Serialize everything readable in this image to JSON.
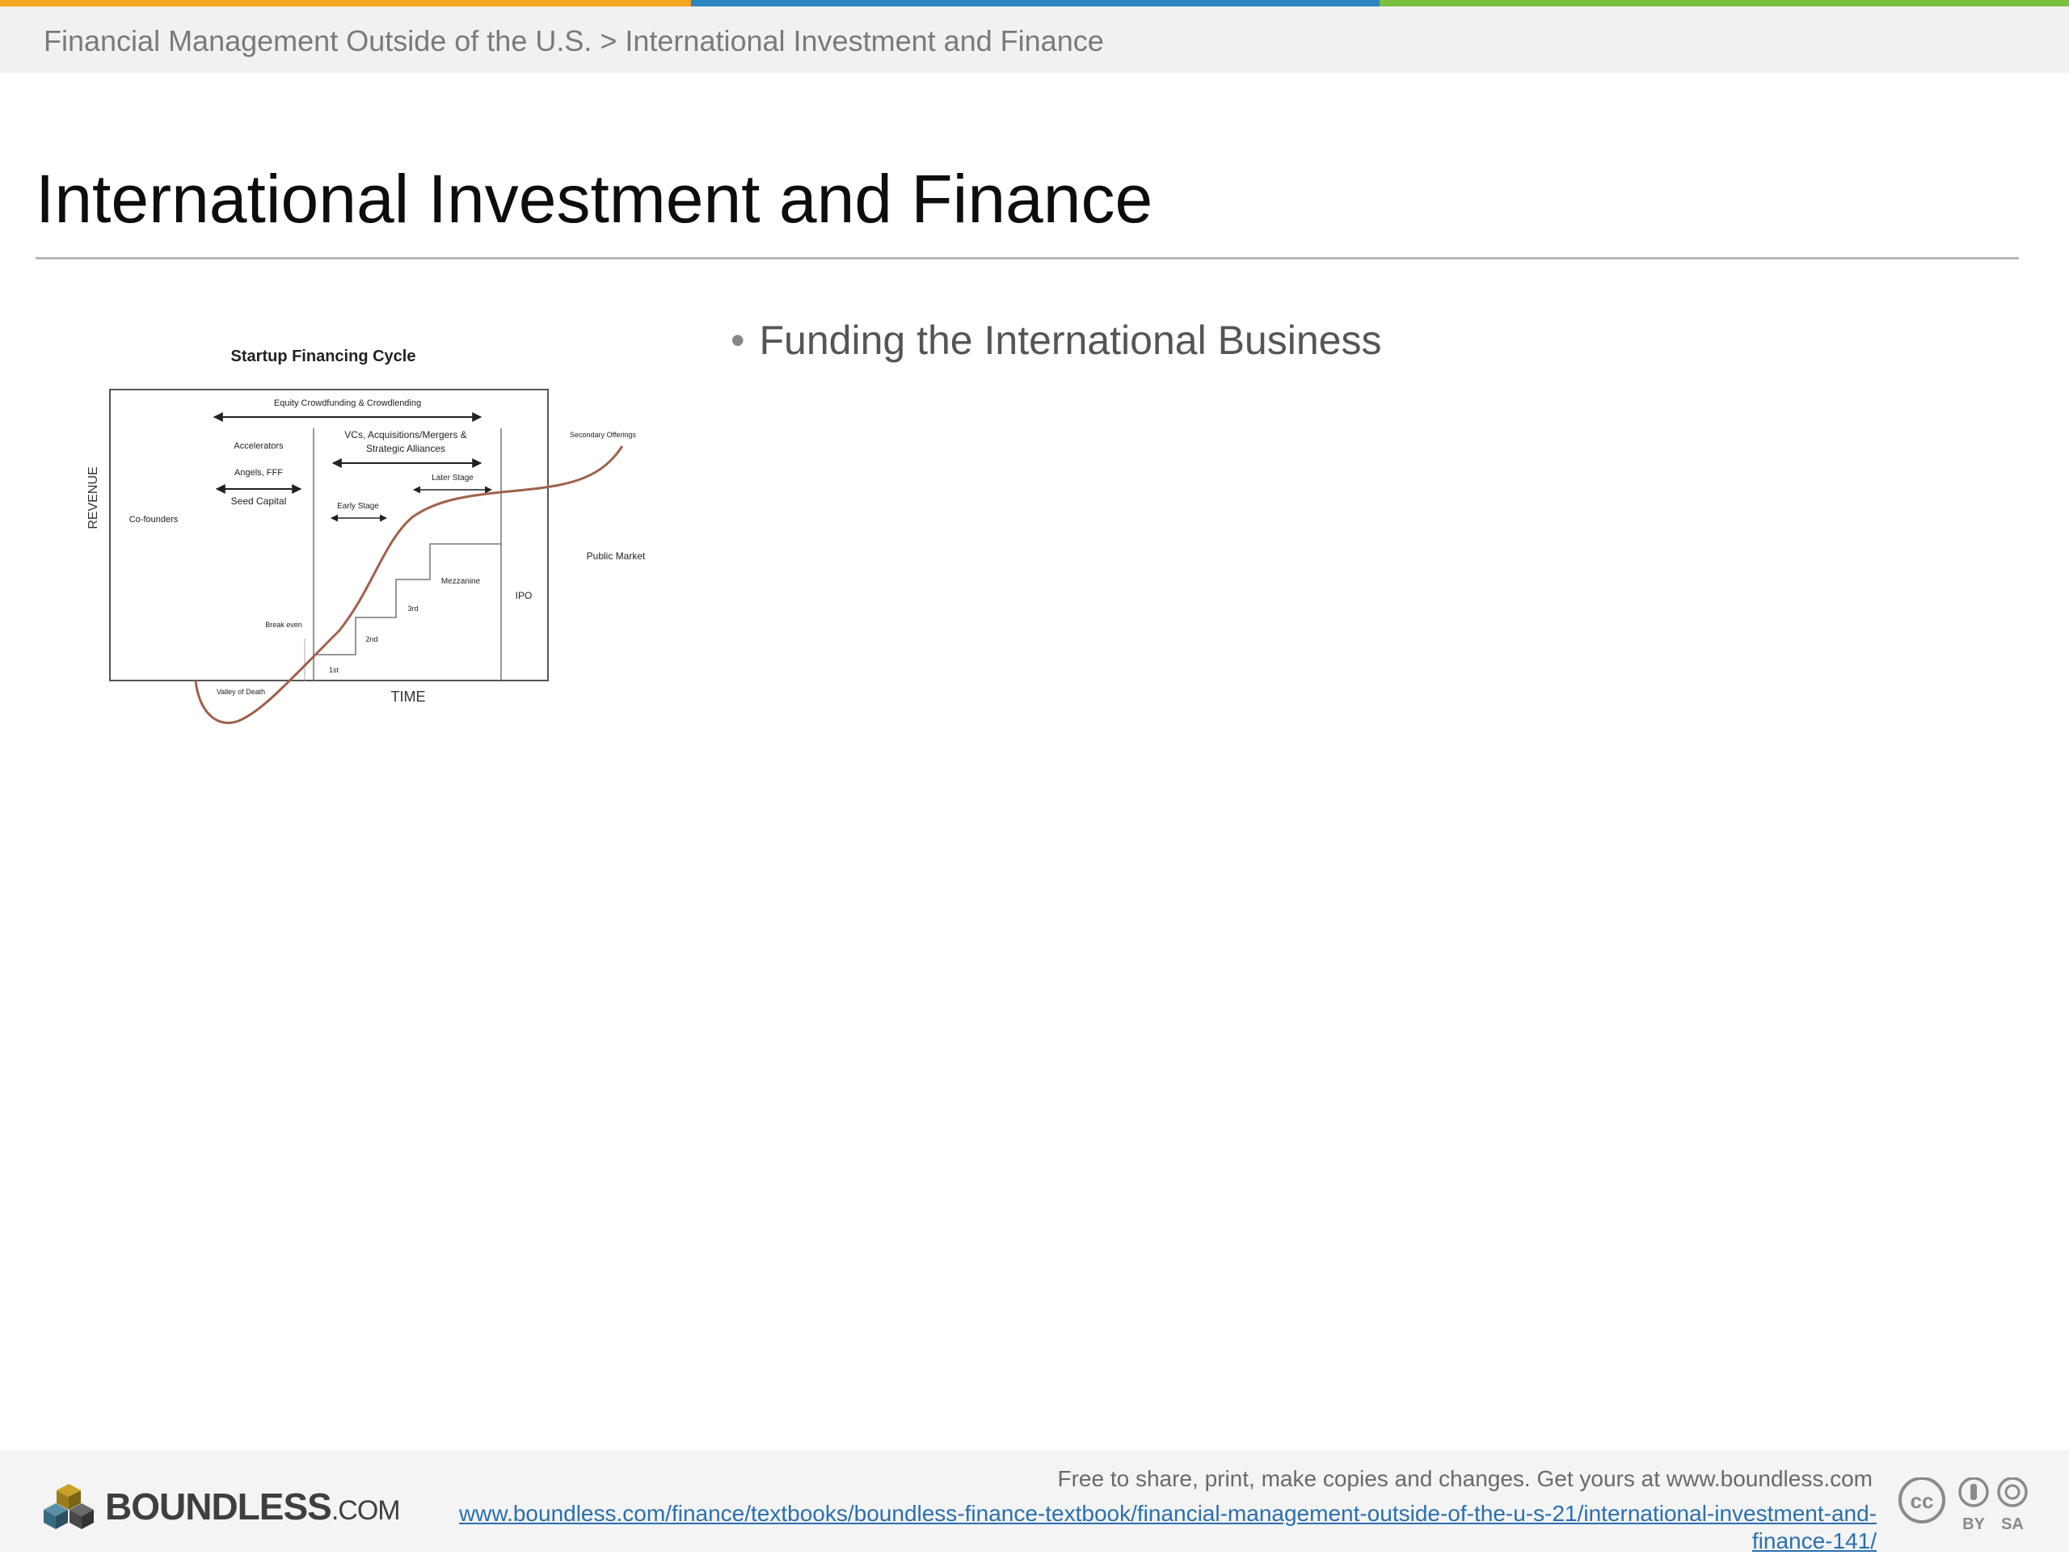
{
  "breadcrumb": "Financial Management Outside of the U.S. > International Investment and Finance",
  "title": "International Investment and Finance",
  "bullets": [
    "Funding the International Business"
  ],
  "colors": {
    "orange": "#f5a623",
    "blue": "#2e86c1",
    "green": "#7ac143",
    "link": "#2a6fb0"
  },
  "diagram": {
    "title": "Startup Financing Cycle",
    "y_label": "REVENUE",
    "x_label": "TIME",
    "labels": {
      "equity_crowdfunding": "Equity Crowdfunding & Crowdlending",
      "accelerators": "Accelerators",
      "angels": "Angels, FFF",
      "seed": "Seed Capital",
      "cofounders": "Co-founders",
      "vcs_line1": "VCs, Acquisitions/Mergers &",
      "vcs_line2": "Strategic Alliances",
      "early_stage": "Early Stage",
      "later_stage": "Later Stage",
      "secondary": "Secondary Offerings",
      "public_market": "Public Market",
      "mezzanine": "Mezzanine",
      "ipo": "IPO",
      "third": "3rd",
      "second": "2nd",
      "first": "1st",
      "break_even": "Break even",
      "valley": "Valley of Death"
    }
  },
  "footer": {
    "logo_main": "BOUNDLESS",
    "logo_suffix": ".COM",
    "share_text": "Free to share, print, make copies and changes. Get yours at www.boundless.com",
    "url": "www.boundless.com/finance/textbooks/boundless-finance-textbook/financial-management-outside-of-the-u-s-21/international-investment-and-finance-141/",
    "cc_by": "BY",
    "cc_sa": "SA"
  }
}
